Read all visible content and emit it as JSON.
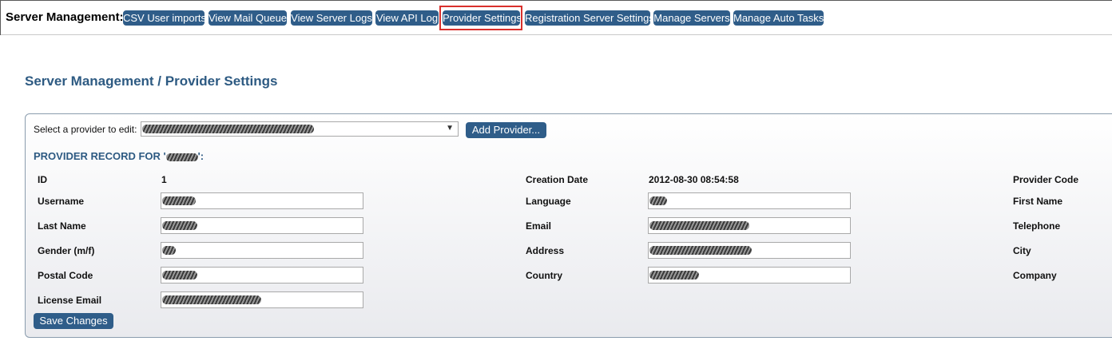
{
  "header": {
    "label": "Server Management:",
    "nav": [
      {
        "label": "CSV User imports"
      },
      {
        "label": "View Mail Queue"
      },
      {
        "label": "View Server Logs"
      },
      {
        "label": "View API Log"
      },
      {
        "label": "Provider Settings",
        "active": true
      },
      {
        "label": "Registration Server Settings"
      },
      {
        "label": "Manage Servers"
      },
      {
        "label": "Manage Auto Tasks"
      }
    ]
  },
  "page": {
    "title": "Server Management / Provider Settings"
  },
  "provider_select": {
    "label": "Select a provider to edit:",
    "value": "",
    "add_button": "Add Provider..."
  },
  "record": {
    "title_prefix": "PROVIDER RECORD FOR '",
    "title_suffix": "':",
    "fields": {
      "id": {
        "label": "ID",
        "value": "1"
      },
      "creation_date": {
        "label": "Creation Date",
        "value": "2012-08-30 08:54:58"
      },
      "provider_code": {
        "label": "Provider Code"
      },
      "username": {
        "label": "Username",
        "value": ""
      },
      "language": {
        "label": "Language",
        "value": ""
      },
      "first_name": {
        "label": "First Name"
      },
      "last_name": {
        "label": "Last Name",
        "value": ""
      },
      "email": {
        "label": "Email",
        "value": ""
      },
      "telephone": {
        "label": "Telephone"
      },
      "gender": {
        "label": "Gender (m/f)",
        "value": ""
      },
      "address": {
        "label": "Address",
        "value": ""
      },
      "city": {
        "label": "City"
      },
      "postal_code": {
        "label": "Postal Code",
        "value": ""
      },
      "country": {
        "label": "Country",
        "value": ""
      },
      "company": {
        "label": "Company"
      },
      "license_email": {
        "label": "License Email",
        "value": ""
      }
    },
    "save_button": "Save Changes"
  },
  "colors": {
    "button_bg": "#2f5d89",
    "title": "#2d5a82",
    "highlight": "#d9302c"
  }
}
